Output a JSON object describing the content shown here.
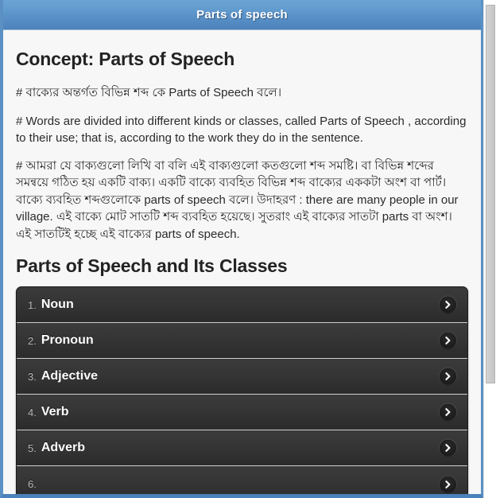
{
  "window": {
    "title": "Parts of speech"
  },
  "content": {
    "heading_1": "Concept: Parts of Speech",
    "paragraph_1": "# বাক্যের অন্তর্গত বিভিন্ন শব্দ কে Parts of Speech বলে।",
    "paragraph_2": "# Words are divided into different kinds or classes, called Parts of Speech , according to their use; that is, according to the work they do in the sentence.",
    "paragraph_3": "# আমরা যে বাক্যগুলো লিখি বা বলি এই বাক্যগুলো কতগুলো শব্দ সমষ্টি। বা বিভিন্ন শব্দের সমন্বয়ে গঠিত হয় একটি বাক্য। একটি বাক্যে ব্যবহিত বিভিন্ন শব্দ বাক্যের এককটা অংশ বা পার্ট। বাক্যে ব্যবহিত শব্দগুলোকে parts of speech বলে। উদাহরণ : there are many people in our village. এই বাক্যে মোট সাতটি শব্দ ব্যবহিত হয়েছে। সুতরাং এই বাক্যের সাতটা parts বা অংশ। এই সাতটিই হচ্ছে এই বাক্যের parts of speech.",
    "heading_2": "Parts of Speech and Its Classes",
    "list": [
      {
        "number": "1.",
        "label": "Noun",
        "icon": "chevron-right-icon"
      },
      {
        "number": "2.",
        "label": "Pronoun",
        "icon": "chevron-right-icon"
      },
      {
        "number": "3.",
        "label": "Adjective",
        "icon": "chevron-right-icon"
      },
      {
        "number": "4.",
        "label": "Verb",
        "icon": "chevron-right-icon"
      },
      {
        "number": "5.",
        "label": "Adverb",
        "icon": "chevron-right-icon"
      },
      {
        "number": "6.",
        "label": "",
        "icon": "chevron-right-icon"
      }
    ]
  },
  "colors": {
    "titlebar_top": "#6ba3d4",
    "titlebar_bottom": "#4d82bb",
    "panel_border": "#5b90c4",
    "page_background": "#f7f7f7",
    "list_background": "#2e2e2e",
    "list_divider": "#cfcfcf",
    "text_primary": "#2b2b2b",
    "heading_color": "#232323",
    "list_label": "#ffffff",
    "list_number": "#b8b8b8"
  }
}
